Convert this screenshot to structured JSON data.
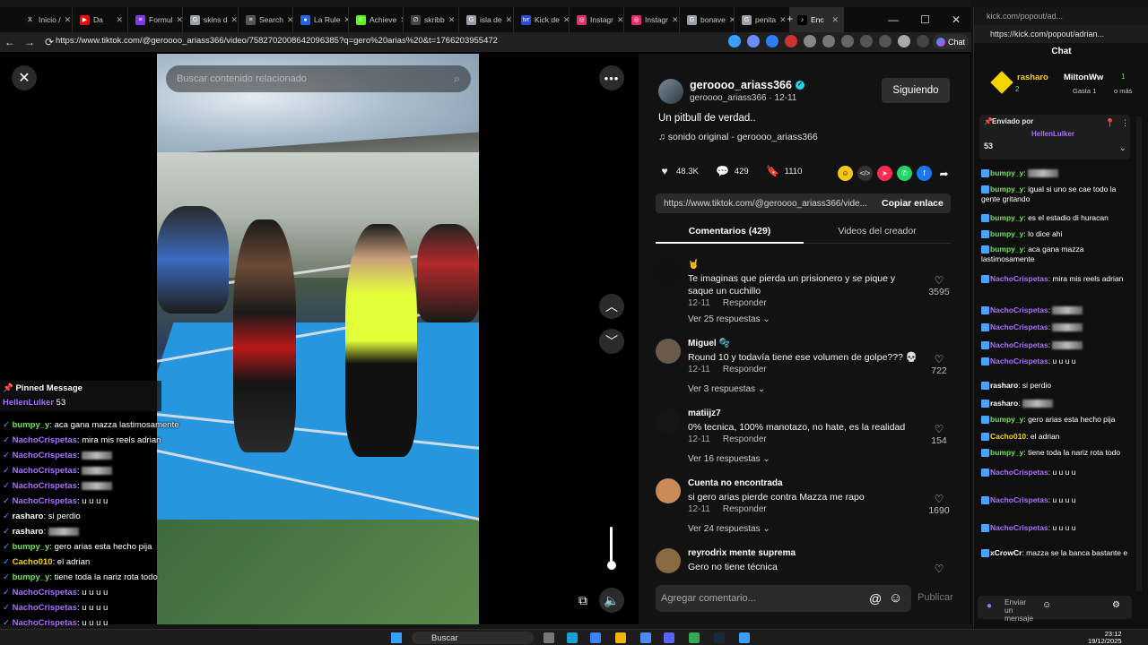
{
  "browser": {
    "tabs": [
      {
        "label": "Inicio /",
        "color": "#111111",
        "glyph": "X"
      },
      {
        "label": "Da",
        "color": "#ff0000",
        "glyph": "▶"
      },
      {
        "label": "Formul",
        "color": "#7c3aed",
        "glyph": "≡"
      },
      {
        "label": "skins d",
        "color": "#9aa0a6",
        "glyph": "G"
      },
      {
        "label": "Search",
        "color": "#555555",
        "glyph": "≡"
      },
      {
        "label": "La Rule",
        "color": "#2563eb",
        "glyph": "●"
      },
      {
        "label": "Achieve",
        "color": "#53fc18",
        "glyph": "K"
      },
      {
        "label": "skribb",
        "color": "#444444",
        "glyph": "∅"
      },
      {
        "label": "isla de",
        "color": "#9aa0a6",
        "glyph": "G"
      },
      {
        "label": "Kick de",
        "color": "#2a4bd6",
        "glyph": "tvr"
      },
      {
        "label": "Instagr",
        "color": "#e1306c",
        "glyph": "◎"
      },
      {
        "label": "Instagr",
        "color": "#e1306c",
        "glyph": "◎"
      },
      {
        "label": "bonave",
        "color": "#9aa0a6",
        "glyph": "G"
      },
      {
        "label": "penita",
        "color": "#9aa0a6",
        "glyph": "G"
      },
      {
        "label": "Enc",
        "color": "#000000",
        "glyph": "♪"
      }
    ],
    "url": "https://www.tiktok.com/@geroooo_ariass366/video/7582702008642096385?q=gero%20arias%20&t=1766203955472",
    "chat_button": "Chat"
  },
  "video": {
    "search_placeholder": "Buscar contenido relacionado"
  },
  "post": {
    "username": "geroooo_ariass366",
    "handle_date": "geroooo_ariass366 · 12-11",
    "follow_label": "Siguiendo",
    "caption": "Un pitbull de verdad..",
    "sound": "sonido original - geroooo_ariass366",
    "likes": "48.3K",
    "comments_count": "429",
    "saves": "1110",
    "link": "https://www.tiktok.com/@geroooo_ariass366/vide...",
    "copy_label": "Copiar enlace",
    "tab_comments": "Comentarios (429)",
    "tab_creator": "Videos del creador"
  },
  "comments": [
    {
      "name": "🤘",
      "text": "Te imaginas que pierda un prisionero y se pique y saque un cuchillo",
      "date": "12-11",
      "reply": "Responder",
      "likes": "3595",
      "more": "Ver 25 respuestas ⌄"
    },
    {
      "name": "Miguel 🫧",
      "text": "Round 10 y todavía tiene ese volumen de golpe??? 💀",
      "date": "12-11",
      "reply": "Responder",
      "likes": "722",
      "more": "Ver 3 respuestas ⌄"
    },
    {
      "name": "matiijz7",
      "text": "0% tecnica, 100% manotazo, no hate, es la realidad",
      "date": "12-11",
      "reply": "Responder",
      "likes": "154",
      "more": "Ver 16 respuestas ⌄"
    },
    {
      "name": "Cuenta no encontrada",
      "text": "si gero arias pierde contra Mazza me rapo",
      "date": "12-11",
      "reply": "Responder",
      "likes": "1690",
      "more": "Ver 24 respuestas ⌄"
    },
    {
      "name": "reyrodrix mente suprema",
      "text": "Gero no tiene técnica",
      "date": "",
      "reply": "",
      "likes": "",
      "more": ""
    }
  ],
  "composer": {
    "placeholder": "Agregar comentario...",
    "publish": "Publicar"
  },
  "overlay_chat": {
    "pinned_title": "Pinned Message",
    "pinned_user": "HellenLulker",
    "pinned_value": "53",
    "lines": [
      {
        "user": "bumpy_y",
        "sep": ":",
        "text": "aca gana mazza lastimosamente",
        "cls": "grn"
      },
      {
        "user": "NachoCrispetas",
        "sep": ":",
        "text": "mira mis reels adrian",
        "cls": "pur"
      },
      {
        "user": "NachoCrispetas",
        "sep": ":",
        "text": "",
        "cls": "pur"
      },
      {
        "user": "NachoCrispetas",
        "sep": ":",
        "text": "",
        "cls": "pur"
      },
      {
        "user": "NachoCrispetas",
        "sep": ":",
        "text": "",
        "cls": "pur"
      },
      {
        "user": "NachoCrispetas",
        "sep": ":",
        "text": "u u u u",
        "cls": "pur"
      },
      {
        "user": "rasharo",
        "sep": ":",
        "text": "si perdio",
        "cls": "wht"
      },
      {
        "user": "rasharo",
        "sep": ":",
        "text": "",
        "cls": "wht"
      },
      {
        "user": "bumpy_y",
        "sep": ":",
        "text": "gero arias esta hecho pija",
        "cls": "grn"
      },
      {
        "user": "Cacho010",
        "sep": ":",
        "text": "el adrian",
        "cls": "yel"
      },
      {
        "user": "bumpy_y",
        "sep": ":",
        "text": "tiene toda la nariz rota todo",
        "cls": "grn"
      },
      {
        "user": "NachoCrispetas",
        "sep": ":",
        "text": "u u u u",
        "cls": "pur"
      },
      {
        "user": "NachoCrispetas",
        "sep": ":",
        "text": "u u u u",
        "cls": "pur"
      },
      {
        "user": "NachoCrispetas",
        "sep": ":",
        "text": "u u u u",
        "cls": "pur"
      },
      {
        "user": "xCrowCr",
        "sep": ":",
        "text": "mazza se la banca bastante e",
        "cls": "wht"
      }
    ]
  },
  "kick": {
    "window_title": "kick.com/popout/ad...",
    "url": "https://kick.com/popout/adrian...",
    "chat_label": "Chat",
    "gift_user1": "rasharo",
    "gift_user2": "MiltonWw",
    "gift_count1": "2",
    "gift_count2": "1",
    "gift_text": "Gasta 1",
    "gift_more": "o más",
    "pinned_by": "Enviado por",
    "pinned_user": "HellenLulker",
    "pinned_value": "53",
    "input_placeholder": "Enviar un mensaje",
    "lines": [
      {
        "user": "bumpy_y",
        "text": "",
        "cls": "grn"
      },
      {
        "user": "bumpy_y",
        "text": "igual si uno se cae todo la gente gritando",
        "cls": "grn"
      },
      {
        "user": "bumpy_y",
        "text": "es el estadio di huracan",
        "cls": "grn"
      },
      {
        "user": "bumpy_y",
        "text": "lo dice ahi",
        "cls": "grn"
      },
      {
        "user": "bumpy_y",
        "text": "aca gana mazza lastimosamente",
        "cls": "grn"
      },
      {
        "user": "NachoCrispetas",
        "text": "mira mis reels adrian",
        "cls": "pur"
      },
      {
        "user": "NachoCrispetas",
        "text": "",
        "cls": "pur"
      },
      {
        "user": "NachoCrispetas",
        "text": "",
        "cls": "pur"
      },
      {
        "user": "NachoCrispetas",
        "text": "",
        "cls": "pur"
      },
      {
        "user": "NachoCrispetas",
        "text": "u u u u",
        "cls": "pur"
      },
      {
        "user": "rasharo",
        "text": "si perdio",
        "cls": "wht"
      },
      {
        "user": "rasharo",
        "text": "",
        "cls": "wht"
      },
      {
        "user": "bumpy_y",
        "text": "gero arias esta hecho pija",
        "cls": "grn"
      },
      {
        "user": "Cacho010",
        "text": "el adrian",
        "cls": "yel"
      },
      {
        "user": "bumpy_y",
        "text": "tiene toda la nariz rota todo",
        "cls": "grn"
      },
      {
        "user": "NachoCrispetas",
        "text": "u u u u",
        "cls": "pur"
      },
      {
        "user": "NachoCrispetas",
        "text": "u u u u",
        "cls": "pur"
      },
      {
        "user": "NachoCrispetas",
        "text": "u u u u",
        "cls": "pur"
      },
      {
        "user": "xCrowCr",
        "text": "mazza se la banca bastante e",
        "cls": "wht"
      }
    ]
  },
  "taskbar": {
    "search": "Buscar",
    "time": "23:12",
    "date": "19/12/2025"
  }
}
